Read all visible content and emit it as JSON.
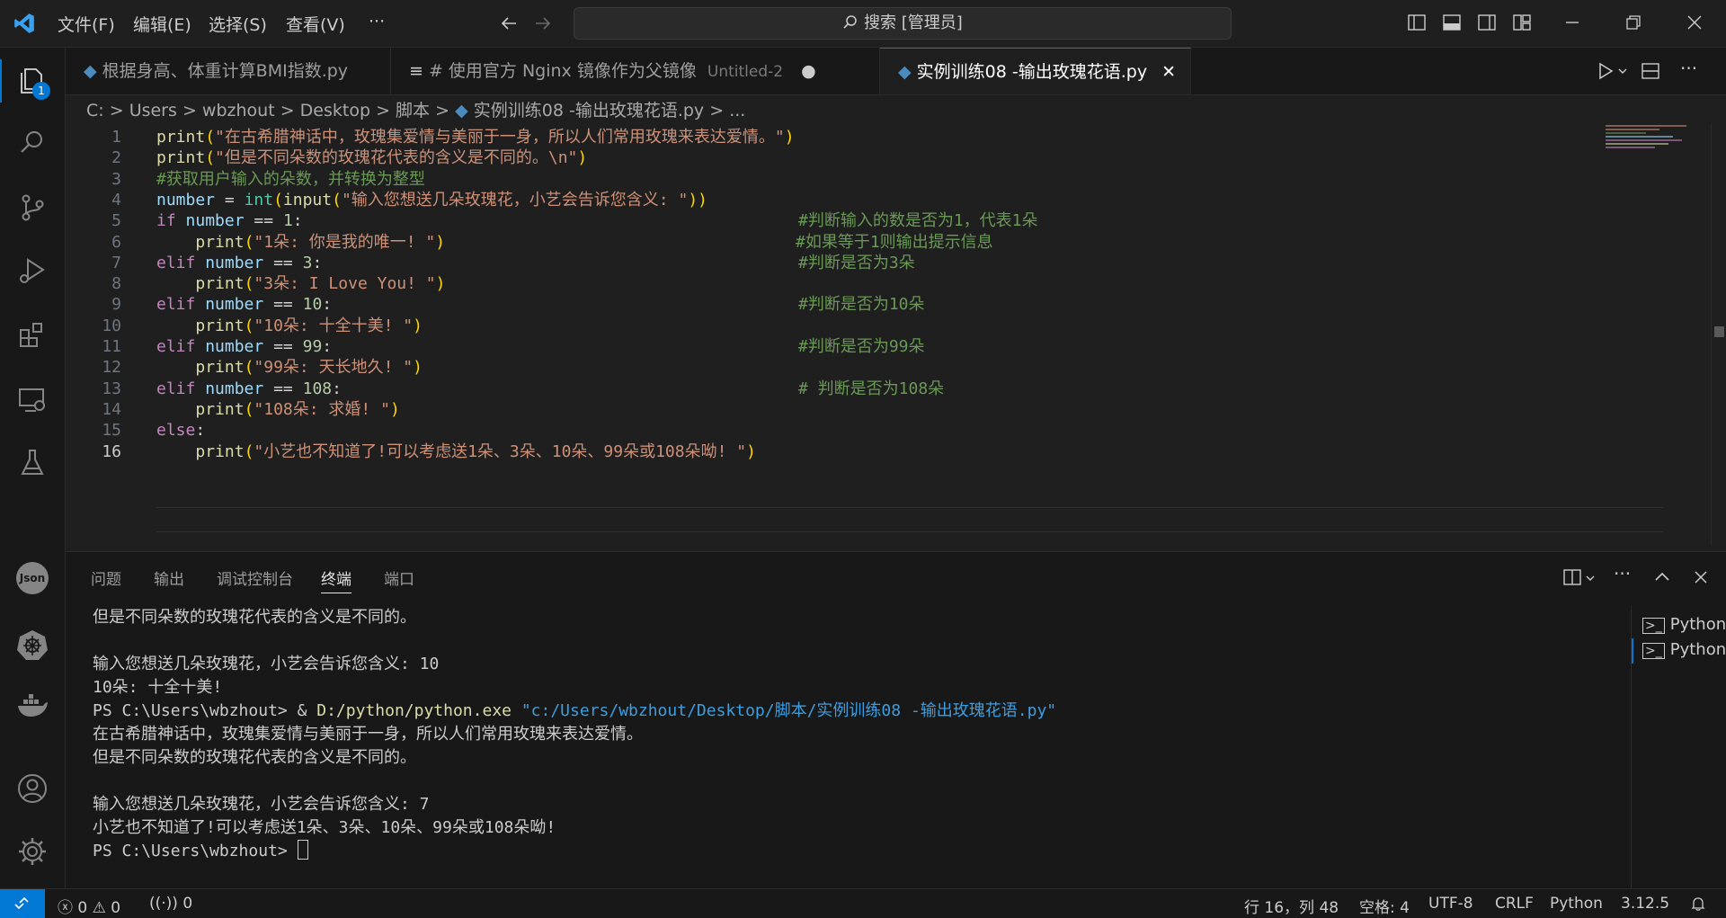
{
  "menu": [
    "文件(F)",
    "编辑(E)",
    "选择(S)",
    "查看(V)",
    "···"
  ],
  "search": {
    "label": "搜索 [管理员]"
  },
  "accent": "#0078d4",
  "activity": {
    "explorer_badge": "1",
    "json_label": "Json"
  },
  "tabs": [
    {
      "label": "根据身高、体重计算BMI指数.py",
      "icon": "python-icon"
    },
    {
      "label": "# 使用官方 Nginx 镜像作为父镜像",
      "sub": "Untitled-2",
      "icon": "menu-lines-icon",
      "modified": "●"
    },
    {
      "label": "实例训练08 -输出玫瑰花语.py",
      "icon": "python-icon",
      "close": "✕"
    }
  ],
  "breadcrumb": [
    "C:",
    ">",
    "Users",
    ">",
    "wbzhout",
    ">",
    "Desktop",
    ">",
    "脚本",
    ">",
    "实例训练08 -输出玫瑰花语.py",
    ">",
    "..."
  ],
  "editor": {
    "current_line": "16",
    "lines": [
      {
        "n": "1",
        "code": "print(\"在古希腊神话中，玫瑰集爱情与美丽于一身，所以人们常用玫瑰来表达爱情。\")",
        "comment": ""
      },
      {
        "n": "2",
        "code": "print(\"但是不同朵数的玫瑰花代表的含义是不同的。\\n\")",
        "comment": ""
      },
      {
        "n": "3",
        "code": "#获取用户输入的朵数，并转换为整型",
        "comment": ""
      },
      {
        "n": "4",
        "code": "number = int(input(\"输入您想送几朵玫瑰花，小艺会告诉您含义: \"))",
        "comment": ""
      },
      {
        "n": "5",
        "code": "if number == 1:",
        "comment": "#判断输入的数是否为1，代表1朵"
      },
      {
        "n": "6",
        "code": "    print(\"1朵: 你是我的唯一! \")",
        "comment": "#如果等于1则输出提示信息"
      },
      {
        "n": "7",
        "code": "elif number == 3:",
        "comment": "#判断是否为3朵"
      },
      {
        "n": "8",
        "code": "    print(\"3朵: I Love You! \")",
        "comment": ""
      },
      {
        "n": "9",
        "code": "elif number == 10:",
        "comment": "#判断是否为10朵"
      },
      {
        "n": "10",
        "code": "    print(\"10朵: 十全十美! \")",
        "comment": ""
      },
      {
        "n": "11",
        "code": "elif number == 99:",
        "comment": "#判断是否为99朵"
      },
      {
        "n": "12",
        "code": "    print(\"99朵: 天长地久! \")",
        "comment": ""
      },
      {
        "n": "13",
        "code": "elif number == 108:",
        "comment": "# 判断是否为108朵"
      },
      {
        "n": "14",
        "code": "    print(\"108朵: 求婚! \")",
        "comment": ""
      },
      {
        "n": "15",
        "code": "else:",
        "comment": ""
      },
      {
        "n": "16",
        "code": "    print(\"小艺也不知道了!可以考虑送1朵、3朵、10朵、99朵或108朵呦! \")",
        "comment": ""
      }
    ]
  },
  "panel": {
    "tabs": [
      "问题",
      "输出",
      "调试控制台",
      "终端",
      "端口"
    ],
    "active_tab": "终端",
    "terminal_lines": [
      "但是不同朵数的玫瑰花代表的含义是不同的。",
      "",
      "输入您想送几朵玫瑰花，小艺会告诉您含义: 10",
      "10朵: 十全十美!",
      "PS C:\\Users\\wbzhout> & D:/python/python.exe \"c:/Users/wbzhout/Desktop/脚本/实例训练08 -输出玫瑰花语.py\"",
      "在古希腊神话中，玫瑰集爱情与美丽于一身，所以人们常用玫瑰来表达爱情。",
      "但是不同朵数的玫瑰花代表的含义是不同的。",
      "",
      "输入您想送几朵玫瑰花，小艺会告诉您含义: 7",
      "小艺也不知道了!可以考虑送1朵、3朵、10朵、99朵或108朵呦!",
      "PS C:\\Users\\wbzhout> "
    ],
    "terminals": [
      "Python",
      "Python"
    ]
  },
  "status": {
    "errors": "0",
    "warnings": "0",
    "ports": "0",
    "cursor": "行 16，列 48",
    "spaces": "空格: 4",
    "encoding": "UTF-8",
    "eol": "CRLF",
    "language": "Python",
    "version": "3.12.5"
  }
}
